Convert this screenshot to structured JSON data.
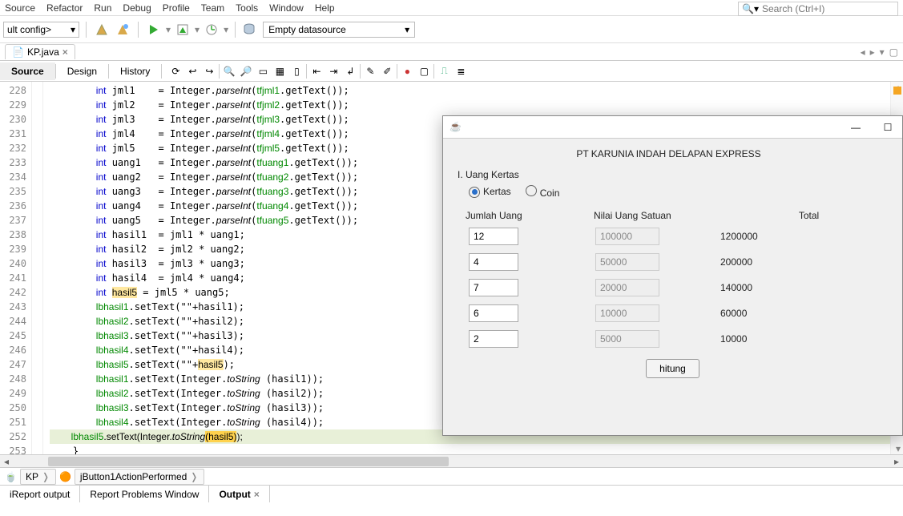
{
  "menu": [
    "Source",
    "Refactor",
    "Run",
    "Debug",
    "Profile",
    "Team",
    "Tools",
    "Window",
    "Help"
  ],
  "search_placeholder": "Search (Ctrl+I)",
  "config_combo": "ult config>",
  "datasource": "Empty datasource",
  "file_tab": "KP.java",
  "view_tabs": {
    "source": "Source",
    "design": "Design",
    "history": "History"
  },
  "code_lines": [
    {
      "n": 228,
      "lhs": "jml1",
      "rhs": "Integer.",
      "mth": "parseInt",
      "arg": "tfjml1",
      "tail": ".getText());"
    },
    {
      "n": 229,
      "lhs": "jml2",
      "rhs": "Integer.",
      "mth": "parseInt",
      "arg": "tfjml2",
      "tail": ".getText());"
    },
    {
      "n": 230,
      "lhs": "jml3",
      "rhs": "Integer.",
      "mth": "parseInt",
      "arg": "tfjml3",
      "tail": ".getText());"
    },
    {
      "n": 231,
      "lhs": "jml4",
      "rhs": "Integer.",
      "mth": "parseInt",
      "arg": "tfjml4",
      "tail": ".getText());"
    },
    {
      "n": 232,
      "lhs": "jml5",
      "rhs": "Integer.",
      "mth": "parseInt",
      "arg": "tfjml5",
      "tail": ".getText());"
    },
    {
      "n": 233,
      "lhs": "uang1",
      "rhs": "Integer.",
      "mth": "parseInt",
      "arg": "tfuang1",
      "tail": ".getText());"
    },
    {
      "n": 234,
      "lhs": "uang2",
      "rhs": "Integer.",
      "mth": "parseInt",
      "arg": "tfuang2",
      "tail": ".getText());"
    },
    {
      "n": 235,
      "lhs": "uang3",
      "rhs": "Integer.",
      "mth": "parseInt",
      "arg": "tfuang3",
      "tail": ".getText());"
    },
    {
      "n": 236,
      "lhs": "uang4",
      "rhs": "Integer.",
      "mth": "parseInt",
      "arg": "tfuang4",
      "tail": ".getText());"
    },
    {
      "n": 237,
      "lhs": "uang5",
      "rhs": "Integer.",
      "mth": "parseInt",
      "arg": "tfuang5",
      "tail": ".getText());"
    }
  ],
  "hasil_lines": [
    {
      "n": 238,
      "v": "hasil1",
      "expr": "jml1 * uang1;"
    },
    {
      "n": 239,
      "v": "hasil2",
      "expr": "jml2 * uang2;"
    },
    {
      "n": 240,
      "v": "hasil3",
      "expr": "jml3 * uang3;"
    },
    {
      "n": 241,
      "v": "hasil4",
      "expr": "jml4 * uang4;"
    },
    {
      "n": 242,
      "v": "hasil5",
      "expr": "jml5 * uang5;",
      "hl": true
    }
  ],
  "set1_lines": [
    {
      "n": 243,
      "obj": "lbhasil1",
      "arg": "hasil1"
    },
    {
      "n": 244,
      "obj": "lbhasil2",
      "arg": "hasil2"
    },
    {
      "n": 245,
      "obj": "lbhasil3",
      "arg": "hasil3"
    },
    {
      "n": 246,
      "obj": "lbhasil4",
      "arg": "hasil4"
    },
    {
      "n": 247,
      "obj": "lbhasil5",
      "arg": "hasil5",
      "hl": true
    }
  ],
  "set2_lines": [
    {
      "n": 248,
      "obj": "lbhasil1",
      "arg": "hasil1"
    },
    {
      "n": 249,
      "obj": "lbhasil2",
      "arg": "hasil2"
    },
    {
      "n": 250,
      "obj": "lbhasil3",
      "arg": "hasil3"
    },
    {
      "n": 251,
      "obj": "lbhasil4",
      "arg": "hasil4"
    },
    {
      "n": 252,
      "obj": "lbhasil5",
      "arg": "hasil5",
      "sel": true
    }
  ],
  "breadcrumb": {
    "a": "KP",
    "b": "jButton1ActionPerformed"
  },
  "bottom_tabs": {
    "a": "iReport output",
    "b": "Report Problems Window",
    "c": "Output"
  },
  "app": {
    "title": "PT KARUNIA INDAH DELAPAN EXPRESS",
    "section": "I. Uang Kertas",
    "radio1": "Kertas",
    "radio2": "Coin",
    "hdr1": "Jumlah Uang",
    "hdr2": "Nilai Uang Satuan",
    "hdr3": "Total",
    "rows": [
      {
        "jml": "12",
        "nom": "100000",
        "total": "1200000"
      },
      {
        "jml": "4",
        "nom": "50000",
        "total": "200000"
      },
      {
        "jml": "7",
        "nom": "20000",
        "total": "140000"
      },
      {
        "jml": "6",
        "nom": "10000",
        "total": "60000"
      },
      {
        "jml": "2",
        "nom": "5000",
        "total": "10000"
      }
    ],
    "button": "hitung"
  }
}
